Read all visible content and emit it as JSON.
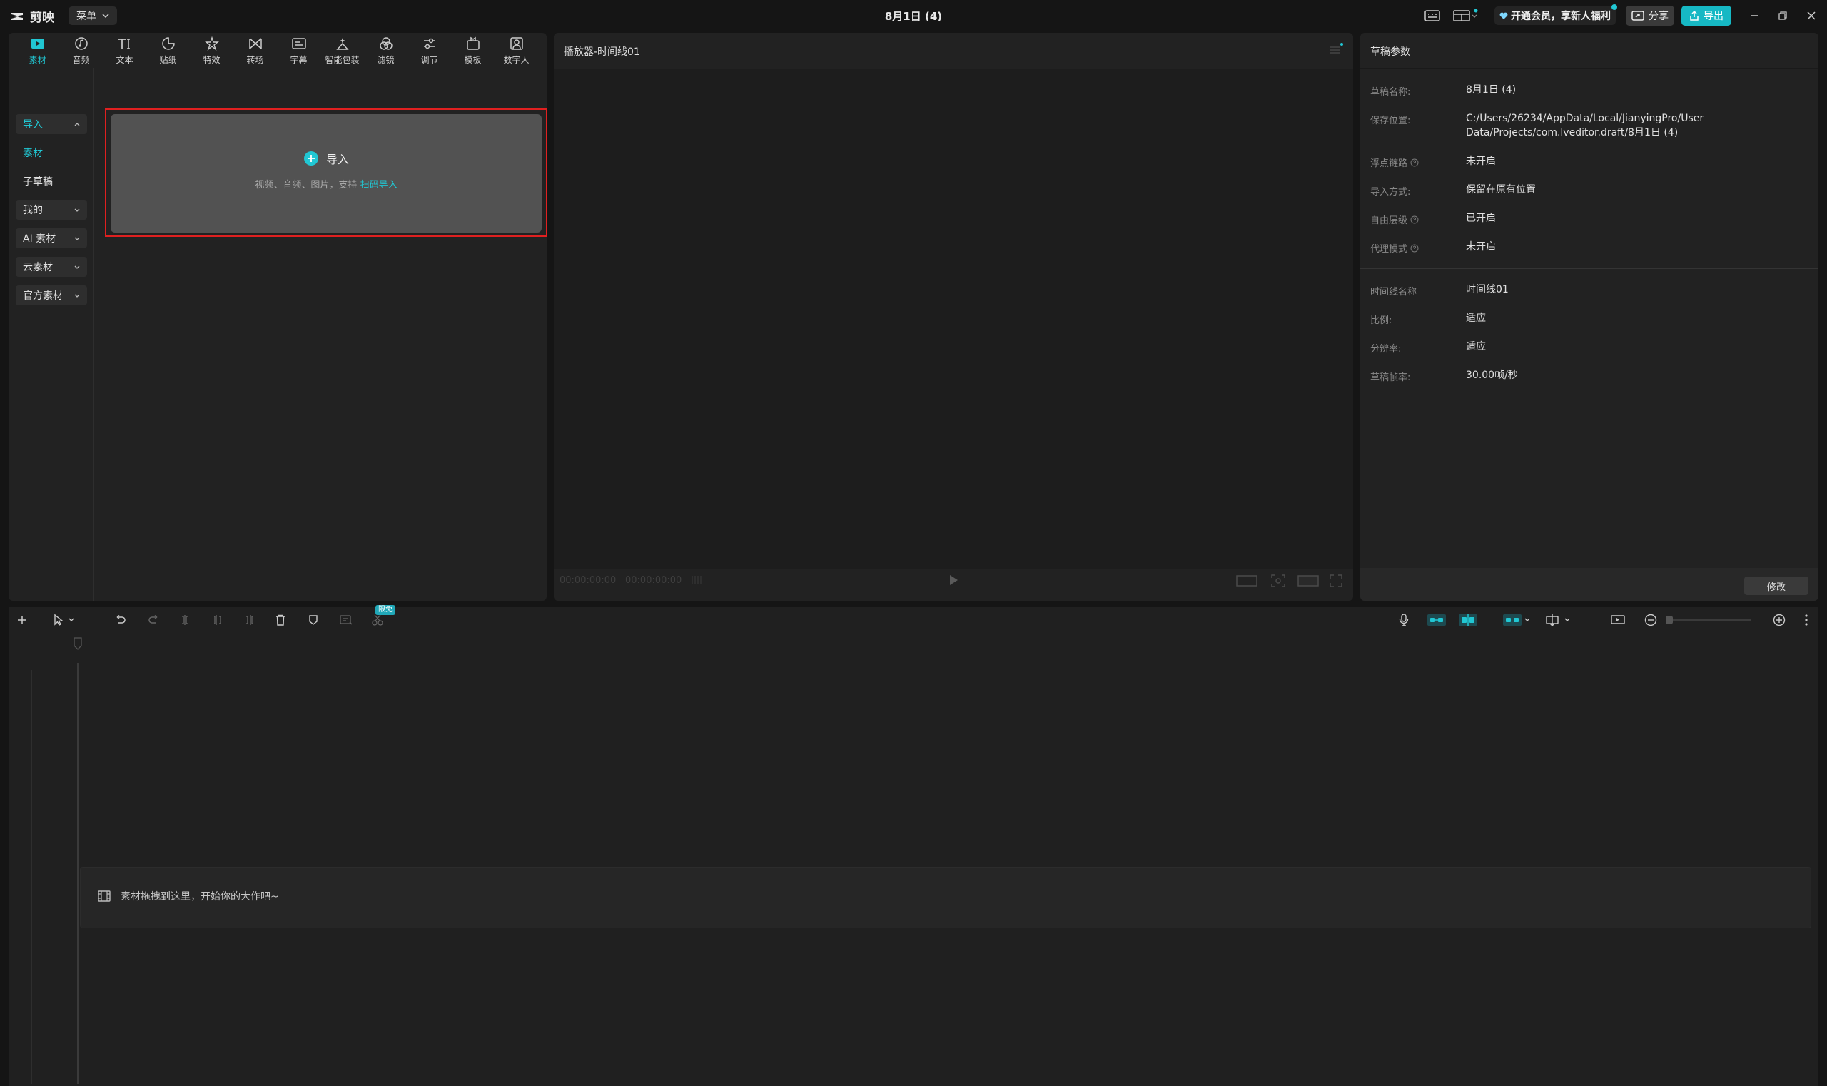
{
  "titlebar": {
    "app_name": "剪映",
    "menu_label": "菜单",
    "window_title": "8月1日 (4)",
    "vip_label": "开通会员，享新人福利",
    "share_label": "分享",
    "export_label": "导出"
  },
  "media_tabs": [
    {
      "label": "素材",
      "icon": "media-icon"
    },
    {
      "label": "音频",
      "icon": "audio-icon"
    },
    {
      "label": "文本",
      "icon": "text-icon"
    },
    {
      "label": "贴纸",
      "icon": "sticker-icon"
    },
    {
      "label": "特效",
      "icon": "effects-icon"
    },
    {
      "label": "转场",
      "icon": "transition-icon"
    },
    {
      "label": "字幕",
      "icon": "subtitle-icon"
    },
    {
      "label": "智能包装",
      "icon": "smart-pack-icon"
    },
    {
      "label": "滤镜",
      "icon": "filter-icon"
    },
    {
      "label": "调节",
      "icon": "adjust-icon"
    },
    {
      "label": "模板",
      "icon": "template-icon"
    },
    {
      "label": "数字人",
      "icon": "digital-human-icon"
    }
  ],
  "sidebar": {
    "items": [
      {
        "label": "导入"
      },
      {
        "label": "素材"
      },
      {
        "label": "子草稿"
      },
      {
        "label": "我的"
      },
      {
        "label": "AI 素材"
      },
      {
        "label": "云素材"
      },
      {
        "label": "官方素材"
      }
    ]
  },
  "import_box": {
    "title": "导入",
    "subtitle": "视频、音频、图片，支持",
    "link": "扫码导入"
  },
  "player": {
    "title": "播放器-时间线01",
    "current_time": "00:00:00:00",
    "total_time": "00:00:00:00"
  },
  "params": {
    "title": "草稿参数",
    "rows": [
      {
        "label": "草稿名称:",
        "value": "8月1日 (4)"
      },
      {
        "label": "保存位置:",
        "value": "C:/Users/26234/AppData/Local/JianyingPro/User Data/Projects/com.lveditor.draft/8月1日 (4)"
      },
      {
        "label": "浮点链路",
        "value": "未开启"
      },
      {
        "label": "导入方式:",
        "value": "保留在原有位置"
      },
      {
        "label": "自由层级",
        "value": "已开启"
      },
      {
        "label": "代理模式",
        "value": "未开启"
      },
      {
        "label": "时间线名称",
        "value": "时间线01"
      },
      {
        "label": "比例:",
        "value": "适应"
      },
      {
        "label": "分辨率:",
        "value": "适应"
      },
      {
        "label": "草稿帧率:",
        "value": "30.00帧/秒"
      }
    ],
    "modify_label": "修改"
  },
  "timeline": {
    "free_badge": "限免",
    "drop_hint": "素材拖拽到这里，开始你的大作吧~"
  },
  "colors": {
    "accent": "#21c7d3",
    "export_bg": "#16b8c4",
    "highlight_border": "#e02020"
  }
}
